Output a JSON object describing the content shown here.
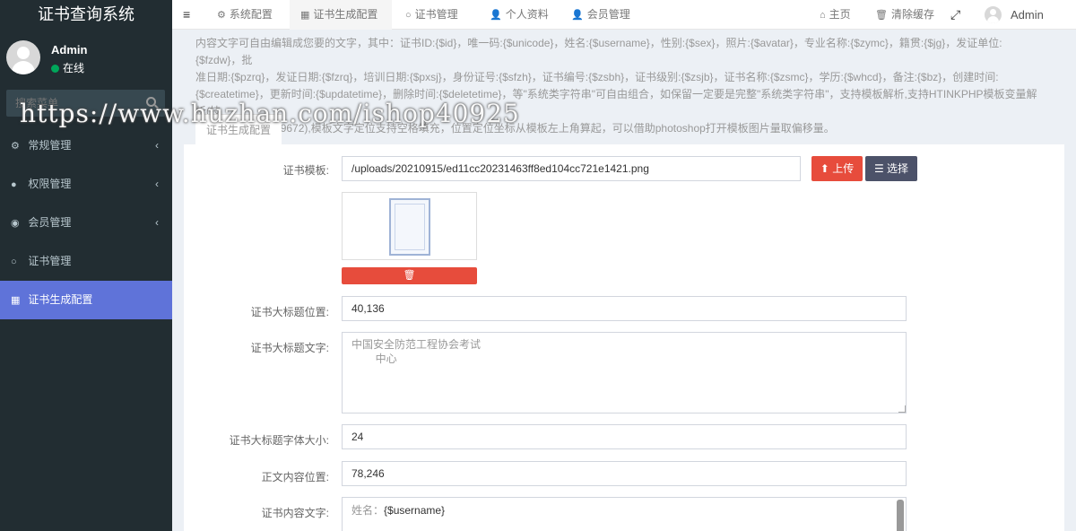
{
  "app": {
    "title": "证书查询系统"
  },
  "user": {
    "name": "Admin",
    "status": "在线"
  },
  "search": {
    "placeholder": "搜索菜单"
  },
  "sidebar": {
    "items": [
      {
        "label": "常规管理",
        "icon": "gears-icon",
        "arrow": "‹"
      },
      {
        "label": "权限管理",
        "icon": "users-icon",
        "arrow": "‹"
      },
      {
        "label": "会员管理",
        "icon": "user-circle-icon",
        "arrow": "‹"
      },
      {
        "label": "证书管理",
        "icon": "circle-icon",
        "arrow": ""
      },
      {
        "label": "证书生成配置",
        "icon": "grid-icon",
        "arrow": ""
      }
    ]
  },
  "navbar": {
    "menu_toggle": "≡",
    "tabs": [
      {
        "label": "系统配置",
        "icon": "gear-icon"
      },
      {
        "label": "证书生成配置",
        "icon": "grid-icon"
      },
      {
        "label": "证书管理",
        "icon": "circle-icon"
      },
      {
        "label": "个人资料",
        "icon": "user-icon"
      },
      {
        "label": "会员管理",
        "icon": "user-icon"
      }
    ],
    "home": "主页",
    "clear_cache": "清除缓存",
    "fullscreen": "⤢",
    "admin": "Admin"
  },
  "hint": {
    "line1": "内容文字可自由编辑成您要的文字，其中：证书ID:{$id}，唯一码:{$unicode}，姓名:{$username}，性别:{$sex}，照片:{$avatar}，专业名称:{$zymc}，籍贯:{$jg}，发证单位:{$fzdw}，批",
    "line2": "准日期:{$pzrq}，发证日期:{$fzrq}，培训日期:{$pxsj}，身份证号:{$sfzh}，证书编号:{$zsbh}，证书级别:{$zsjb}，证书名称:{$zsmc}，学历:{$whcd}，备注:{$bz}，创建时间:",
    "line3": "{$createtime}，更新时间:{$updatetime}，删除时间:{$deletetime}，等\"系统类字符串\"可自由组合，如保留一定要是完整\"系统类字符串\"，支持模板解析,支持HTINKPHP模板变量解析(技",
    "line4": "术驱动QQ1806199672),模板文字定位支持空格填充，位置定位坐标从模板左上角算起，可以借助photoshop打开模板图片量取偏移量。"
  },
  "tab": {
    "label": "证书生成配置"
  },
  "form": {
    "template_label": "证书模板:",
    "template_value": "/uploads/20210915/ed11cc20231463ff8ed104cc721e1421.png",
    "upload_button": "上传",
    "select_button": "选择",
    "title_pos_label": "证书大标题位置:",
    "title_pos_value": "40,136",
    "title_text_label": "证书大标题文字:",
    "title_text_value": "中国安全防范工程协会考试\n        中心",
    "title_size_label": "证书大标题字体大小:",
    "title_size_value": "24",
    "body_pos_label": "正文内容位置:",
    "body_pos_value": "78,246",
    "body_text_label": "证书内容文字:",
    "body_text_prefix": "姓名：",
    "body_text_var": "{$username}"
  },
  "watermark": "https://www.huzhan.com/ishop40925",
  "colors": {
    "sidebar": "#222d32",
    "active": "#5f73d9",
    "danger": "#e74c3c",
    "dark_button": "#4c5269",
    "online": "#00a65a"
  }
}
